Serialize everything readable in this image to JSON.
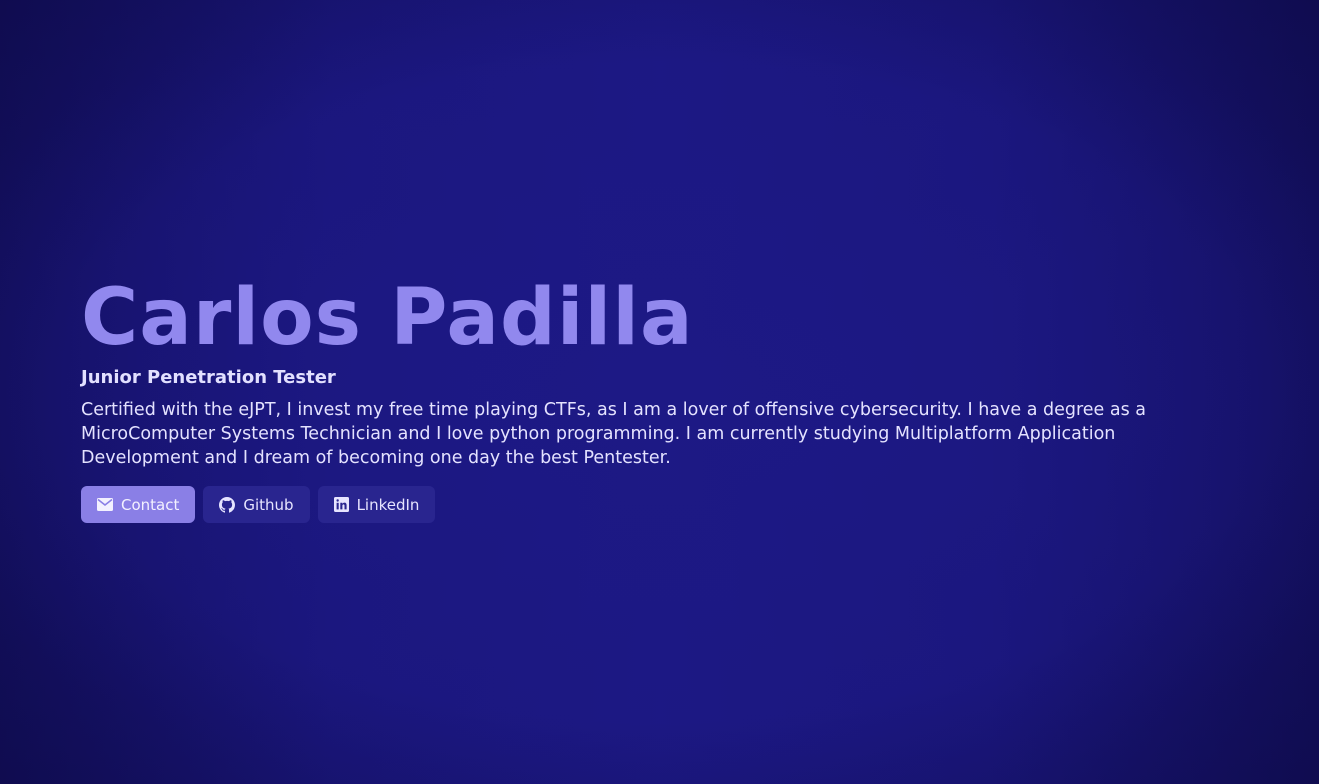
{
  "hero": {
    "name": "Carlos Padilla",
    "role": "Junior Penetration Tester",
    "bio": "Certified with the eJPT, I invest my free time playing CTFs, as I am a lover of offensive cybersecurity. I have a degree as a MicroComputer Systems Technician and I love python programming. I am currently studying Multiplatform Application Development and I dream of becoming one day the best Pentester."
  },
  "actions": {
    "contact": {
      "label": "Contact",
      "icon": "envelope-icon"
    },
    "github": {
      "label": "Github",
      "icon": "github-icon"
    },
    "linkedin": {
      "label": "LinkedIn",
      "icon": "linkedin-icon"
    }
  },
  "colors": {
    "background": "#1a167c",
    "name": "#9188ee",
    "primary_button": "#8a7fe6",
    "secondary_button": "#29258f",
    "text": "#e4e2ff"
  }
}
